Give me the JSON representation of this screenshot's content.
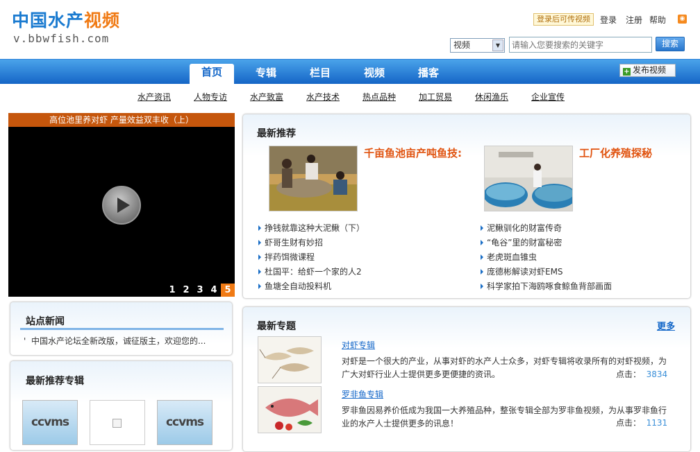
{
  "header": {
    "logo_part1": "中国水产",
    "logo_part2": "视频",
    "logo_url": "v.bbwfish.com",
    "login_hint": "登录后可传视频",
    "login": "登录",
    "register": "注册",
    "help": "帮助",
    "search_select": "视频",
    "search_placeholder": "请输入您要搜索的关键字",
    "search_button": "搜索"
  },
  "nav": {
    "items": [
      "首页",
      "专辑",
      "栏目",
      "视频",
      "播客"
    ],
    "active": "首页",
    "publish": "发布视频",
    "sub_items": [
      "水产资讯",
      "人物专访",
      "水产致富",
      "水产技术",
      "热点品种",
      "加工贸易",
      "休闲渔乐",
      "企业宣传"
    ]
  },
  "player": {
    "title": "高位池里养对虾  产量效益双丰收（上）",
    "pages": [
      "1",
      "2",
      "3",
      "4",
      "5"
    ],
    "current_page": "5"
  },
  "site_news": {
    "title": "站点新闻",
    "items": [
      "中国水产论坛全新改版，诚征版主，欢迎您的..."
    ]
  },
  "recommended_albums": {
    "title": "最新推荐专辑",
    "items": [
      "ccvms",
      "",
      "ccvms"
    ]
  },
  "latest_recommend": {
    "title": "最新推荐",
    "featured": [
      {
        "title": "千亩鱼池亩产吨鱼技:"
      },
      {
        "title": "工厂化养殖探秘"
      }
    ],
    "left_list": [
      "挣钱就靠这种大泥鳅（下）",
      "虾哥生财有妙招",
      "拌药饵微课程",
      "杜国平：给虾一个家的人2",
      "鱼塘全自动投料机"
    ],
    "right_list": [
      "泥鳅驯化的财富传奇",
      "“龟谷”里的财富秘密",
      "老虎斑血锥虫",
      "庞德彬解读对虾EMS",
      "科学家拍下海鸥啄食鲸鱼背部画面"
    ]
  },
  "latest_topics": {
    "title": "最新专题",
    "more": "更多",
    "items": [
      {
        "name": "对虾专辑",
        "desc": "对虾是一个很大的产业，从事对虾的水产人士众多，对虾专辑将收录所有的对虾视频，为广大对虾行业人士提供更多更便捷的资讯。",
        "clicks_label": "点击：",
        "clicks": "3834"
      },
      {
        "name": "罗非鱼专辑",
        "desc": "罗非鱼因易养价低成为我国一大养殖品种，整张专辑全部为罗非鱼视频，为从事罗非鱼行业的水产人士提供更多的讯息！",
        "clicks_label": "点击：",
        "clicks": "1131"
      }
    ]
  },
  "colors": {
    "brand_blue": "#1b7bd0",
    "brand_orange": "#f07a14",
    "nav_blue": "#1565c6",
    "headline_red": "#e0520e"
  }
}
